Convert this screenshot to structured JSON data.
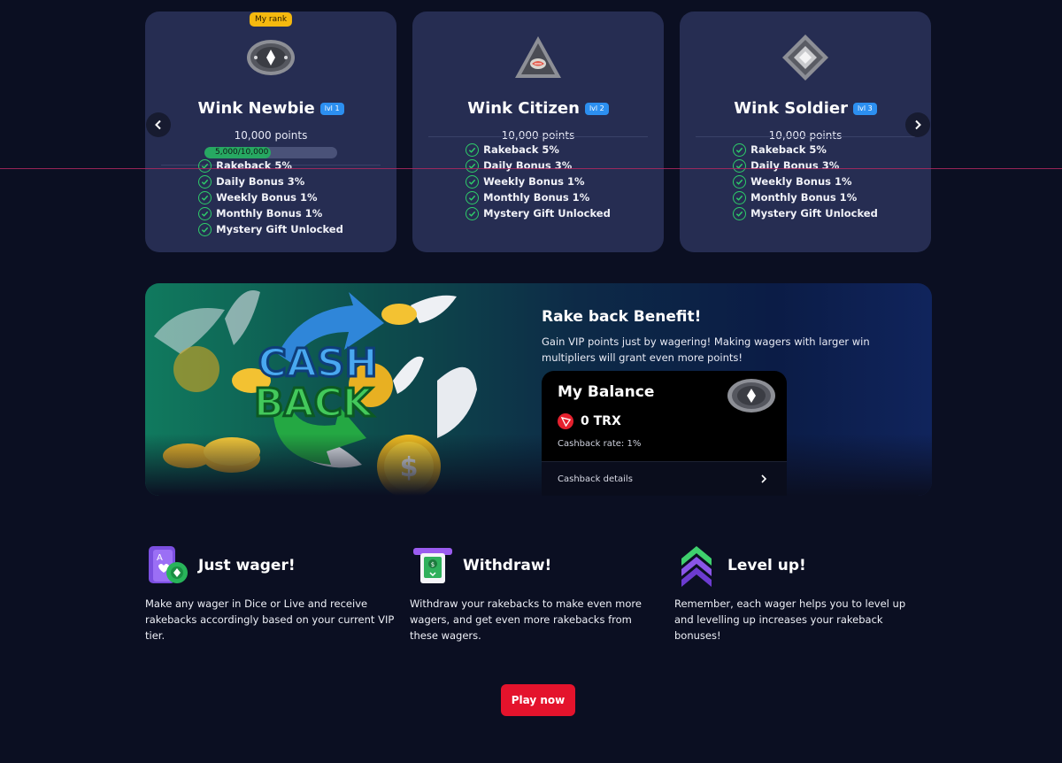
{
  "tiers": [
    {
      "rank_tag": "My rank",
      "name": "Wink Newbie",
      "level": "lvl 1",
      "points": "10,000 points",
      "progress_text": "5,000/10,000",
      "progress_fraction": 0.5,
      "benefits": [
        "Rakeback 5%",
        "Daily Bonus 3%",
        "Weekly Bonus 1%",
        "Monthly Bonus 1%",
        "Mystery Gift Unlocked"
      ]
    },
    {
      "name": "Wink Citizen",
      "level": "lvl 2",
      "points": "10,000 points",
      "benefits": [
        "Rakeback 5%",
        "Daily Bonus 3%",
        "Weekly Bonus 1%",
        "Monthly Bonus 1%",
        "Mystery Gift Unlocked"
      ]
    },
    {
      "name": "Wink Soldier",
      "level": "lvl 3",
      "points": "10,000 points",
      "benefits": [
        "Rakeback 5%",
        "Daily Bonus 3%",
        "Weekly Bonus 1%",
        "Monthly Bonus 1%",
        "Mystery Gift Unlocked"
      ]
    }
  ],
  "carousel": {
    "prev_icon": "chevron-left-icon",
    "next_icon": "chevron-right-icon"
  },
  "rakeback": {
    "art_text_line1": "CASH",
    "art_text_line2": "BACK",
    "title": "Rake back Benefit!",
    "description": "Gain VIP points just by wagering! Making wagers with larger win multipliers will grant even more points!",
    "balance": {
      "title": "My Balance",
      "amount": "0 TRX",
      "cashback_rate": "Cashback rate: 1%",
      "details_label": "Cashback details",
      "details_icon": "chevron-right-icon"
    }
  },
  "steps": [
    {
      "icon": "cards-chip-icon",
      "title": "Just wager!",
      "text": "Make any wager in Dice or Live and receive rakebacks accordingly based on your current VIP tier."
    },
    {
      "icon": "atm-withdraw-icon",
      "title": "Withdraw!",
      "text": "Withdraw your rakebacks to make even more wagers, and get even more rakebacks from these wagers."
    },
    {
      "icon": "level-up-chevrons-icon",
      "title": "Level up!",
      "text": "Remember, each wager helps you to level up and levelling up increases your rakeback bonuses!"
    }
  ],
  "cta": {
    "label": "Play now"
  },
  "colors": {
    "background": "#0b0f22",
    "card": "#262d52",
    "accent_green": "#2ecc6a",
    "badge_blue": "#2c8ff0",
    "rank_yellow": "#f5b90f",
    "cta_red": "#e4132c",
    "trx_red": "#e5212e"
  }
}
